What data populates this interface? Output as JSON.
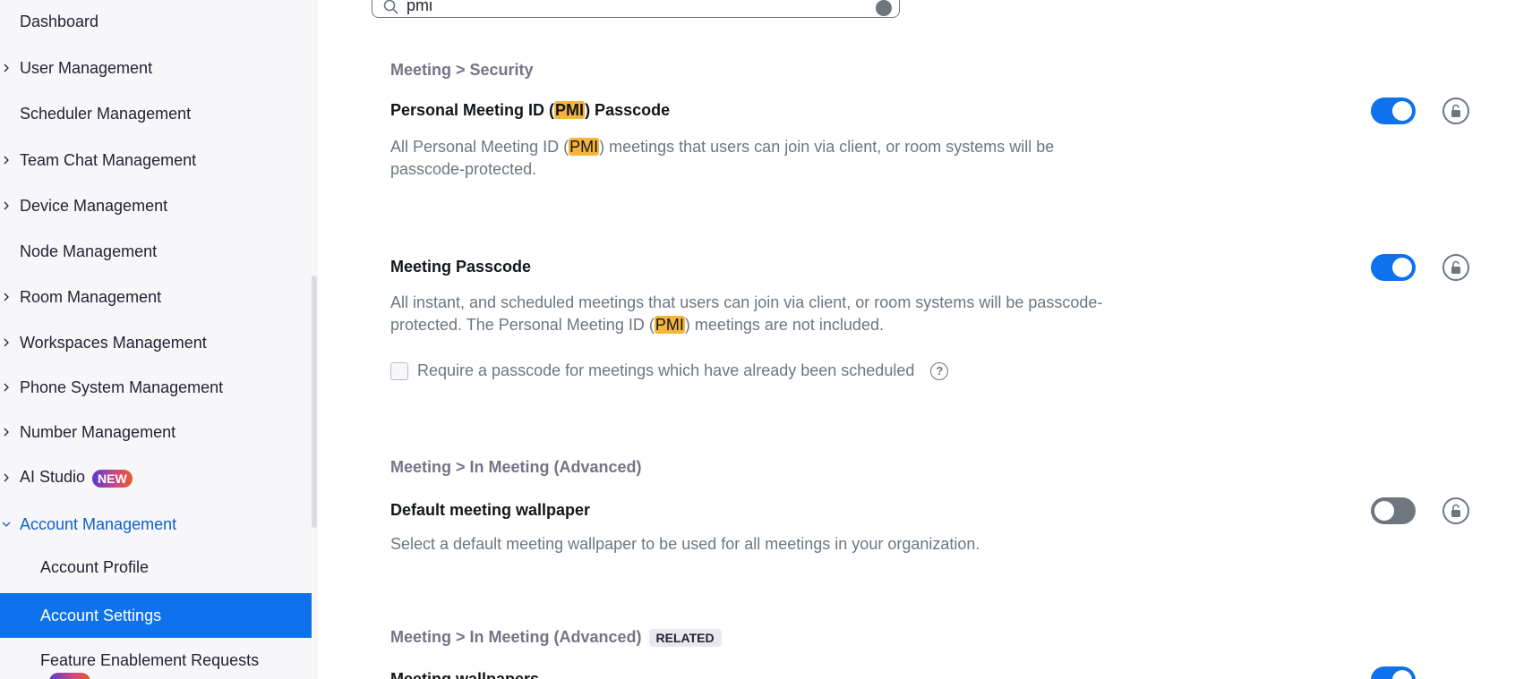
{
  "sidebar": {
    "items": [
      {
        "label": "Dashboard",
        "has_chevron": false
      },
      {
        "label": "User Management",
        "has_chevron": true
      },
      {
        "label": "Scheduler Management",
        "has_chevron": false
      },
      {
        "label": "Team Chat Management",
        "has_chevron": true
      },
      {
        "label": "Device Management",
        "has_chevron": true
      },
      {
        "label": "Node Management",
        "has_chevron": false
      },
      {
        "label": "Room Management",
        "has_chevron": true
      },
      {
        "label": "Workspaces Management",
        "has_chevron": true
      },
      {
        "label": "Phone System Management",
        "has_chevron": true
      },
      {
        "label": "Number Management",
        "has_chevron": true
      },
      {
        "label": "AI Studio",
        "has_chevron": true,
        "badge": "NEW"
      },
      {
        "label": "Account Management",
        "has_chevron": true,
        "expanded": true
      }
    ],
    "sub_items": [
      {
        "label": "Account Profile"
      },
      {
        "label": "Account Settings",
        "active": true
      },
      {
        "label": "Feature Enablement Requests"
      }
    ]
  },
  "search": {
    "value": "pmi"
  },
  "sections": {
    "security_breadcrumb": "Meeting > Security",
    "pmi_passcode": {
      "title_pre": "Personal Meeting ID (",
      "title_hl": "PMI",
      "title_post": ") Passcode",
      "desc_pre": "All Personal Meeting ID (",
      "desc_hl": "PMI",
      "desc_post": ") meetings that users can join via client, or room systems will be passcode-protected.",
      "enabled": true
    },
    "meeting_passcode": {
      "title": "Meeting Passcode",
      "desc_pre": "All instant, and scheduled meetings that users can join via client, or room systems will be passcode-protected. The Personal Meeting ID (",
      "desc_hl": "PMI",
      "desc_post": ") meetings are not included.",
      "checkbox_label": "Require a passcode for meetings which have already been scheduled",
      "help": "?",
      "enabled": true
    },
    "in_meeting_breadcrumb": "Meeting > In Meeting (Advanced)",
    "default_wallpaper": {
      "title": "Default meeting wallpaper",
      "desc": "Select a default meeting wallpaper to be used for all meetings in your organization.",
      "enabled": false
    },
    "related_breadcrumb": "Meeting > In Meeting (Advanced)",
    "related_tag": "RELATED",
    "meeting_wallpapers": {
      "title": "Meeting wallpapers",
      "enabled": true
    }
  },
  "colors": {
    "accent": "#0e72ed",
    "highlight": "#f5b43a",
    "toggle_off": "#6e7680",
    "sidebar_bg": "#f7f7fa"
  },
  "icons": {
    "chevron": "chevron-right-icon",
    "chevron_expanded": "chevron-down-icon",
    "search": "search-icon",
    "clear": "clear-icon",
    "lock": "unlock-icon",
    "help": "help-icon"
  }
}
